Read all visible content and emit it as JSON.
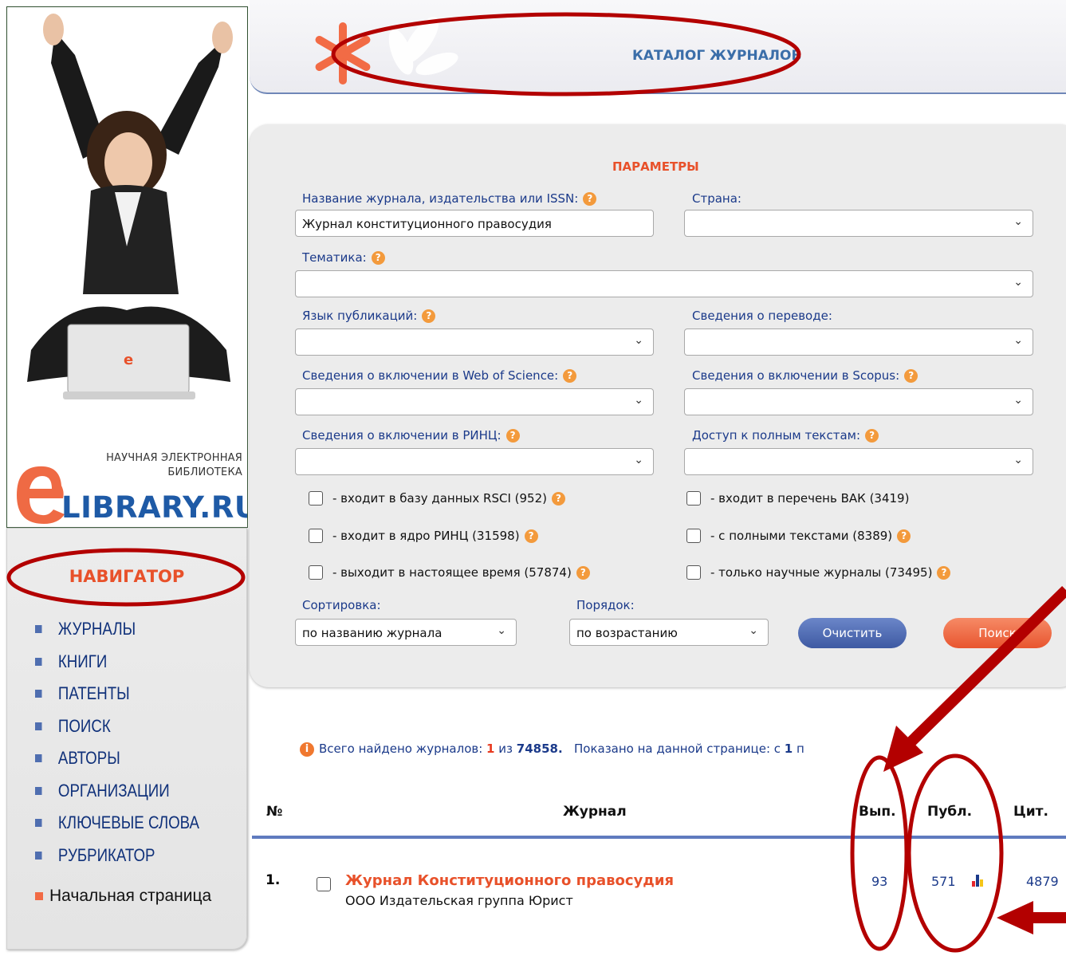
{
  "sidebar": {
    "logo_line1": "НАУЧНАЯ ЭЛЕКТРОННАЯ",
    "logo_line2": "БИБЛИОТЕКА",
    "logo_big": "LIBRARY.RU",
    "navigator_title": "НАВИГАТОР",
    "items": [
      {
        "label": "ЖУРНАЛЫ"
      },
      {
        "label": "КНИГИ"
      },
      {
        "label": "ПАТЕНТЫ"
      },
      {
        "label": "ПОИСК"
      },
      {
        "label": "АВТОРЫ"
      },
      {
        "label": "ОРГАНИЗАЦИИ"
      },
      {
        "label": "КЛЮЧЕВЫЕ СЛОВА"
      },
      {
        "label": "РУБРИКАТОР"
      }
    ],
    "home_label": "Начальная страница"
  },
  "header": {
    "title": "КАТАЛОГ ЖУРНАЛОВ"
  },
  "params": {
    "title": "ПАРАМЕТРЫ",
    "journal_name_label": "Название журнала, издательства или ISSN:",
    "journal_name_value": "Журнал конституционного правосудия",
    "country_label": "Страна:",
    "country_value": "",
    "topic_label": "Тематика:",
    "topic_value": "",
    "language_label": "Язык публикаций:",
    "language_value": "",
    "translation_label": "Сведения о переводе:",
    "translation_value": "",
    "wos_label": "Сведения о включении в Web of Science:",
    "wos_value": "",
    "scopus_label": "Сведения о включении в Scopus:",
    "scopus_value": "",
    "rinc_label": "Сведения о включении в РИНЦ:",
    "rinc_value": "",
    "fulltext_label": "Доступ к полным текстам:",
    "fulltext_value": "",
    "checkboxes": [
      {
        "label": "- входит в базу данных RSCI (952)",
        "checked": false
      },
      {
        "label": "- входит в перечень ВАК (3419)",
        "checked": false
      },
      {
        "label": "- входит в ядро РИНЦ (31598)",
        "checked": false
      },
      {
        "label": "- с полными текстами (8389)",
        "checked": false
      },
      {
        "label": "- выходит в настоящее время (57874)",
        "checked": false
      },
      {
        "label": "- только научные журналы (73495)",
        "checked": false
      }
    ],
    "sort_label": "Сортировка:",
    "sort_value": "по названию журнала",
    "order_label": "Порядок:",
    "order_value": "по возрастанию",
    "clear_label": "Очистить",
    "search_label": "Поиск",
    "help_glyph": "?"
  },
  "results": {
    "info_icon": "i",
    "info_prefix": "Всего найдено журналов:",
    "found": "1",
    "of_word": "из",
    "total": "74858.",
    "shown_prefix": "Показано на данной странице: с",
    "shown_from": "1",
    "shown_rest": "п",
    "columns": {
      "num": "№",
      "journal": "Журнал",
      "issues": "Вып.",
      "pubs": "Публ.",
      "cites": "Цит."
    },
    "rows": [
      {
        "num": "1.",
        "title": "Журнал Конституционного правосудия",
        "publisher": "ООО Издательская группа Юрист",
        "issues": "93",
        "pubs": "571",
        "cites": "4879"
      }
    ]
  },
  "colors": {
    "accent_orange": "#e8512a",
    "link_blue": "#1b3a8a",
    "annotation_red": "#b30000"
  }
}
